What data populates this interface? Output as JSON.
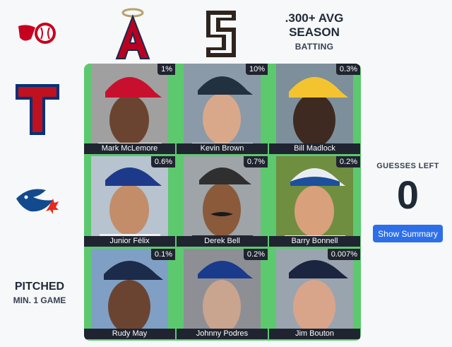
{
  "columns": [
    {
      "team": "angels-logo",
      "text": "A"
    },
    {
      "team": "padres-logo",
      "text": "SD"
    },
    {
      "title": ".300+ AVG SEASON",
      "subtitle": "BATTING"
    }
  ],
  "header": {
    "title_line1": ".300+ AVG",
    "title_line2": "SEASON",
    "subtitle": "BATTING"
  },
  "rows": [
    {
      "team": "reds-logo"
    },
    {
      "team": "rangers-logo",
      "text": "T"
    },
    {
      "team": "blue-jays-logo"
    }
  ],
  "row_criterion": {
    "title": "PITCHED",
    "subtitle": "MIN. 1 GAME"
  },
  "cells": [
    {
      "name": "Mark McLemore",
      "pct": "1%",
      "cap": "#c8102e",
      "skin": "#6b4431",
      "bg": "#a0a0a0"
    },
    {
      "name": "Kevin Brown",
      "pct": "10%",
      "cap": "#22313f",
      "skin": "#d9a88a",
      "bg": "#8a9aa8"
    },
    {
      "name": "Bill Madlock",
      "pct": "0.3%",
      "cap": "#f4c430",
      "skin": "#3e2a20",
      "bg": "#7d8f9a"
    },
    {
      "name": "Junior Félix",
      "pct": "0.6%",
      "cap": "#1d3a8a",
      "skin": "#c38d6a",
      "bg": "#b7c3cf"
    },
    {
      "name": "Derek Bell",
      "pct": "0.7%",
      "cap": "#2f2f2f",
      "skin": "#8a5a3b",
      "bg": "#9ea4a8"
    },
    {
      "name": "Barry Bonnell",
      "pct": "0.2%",
      "cap": "#e9edf2",
      "skin": "#d9a07c",
      "bg": "#6f8e3f"
    },
    {
      "name": "Rudy May",
      "pct": "0.1%",
      "cap": "#1c2b4a",
      "skin": "#6b4431",
      "bg": "#7fa0c4"
    },
    {
      "name": "Johnny Podres",
      "pct": "0.2%",
      "cap": "#1a3a8c",
      "skin": "#c9a48f",
      "bg": "#8d8f95"
    },
    {
      "name": "Jim Bouton",
      "pct": "0.007%",
      "cap": "#1b2540",
      "skin": "#d8a58a",
      "bg": "#9aa4ae"
    }
  ],
  "guesses": {
    "label": "GUESSES LEFT",
    "value": "0"
  },
  "summary_button": "Show Summary",
  "colors": {
    "grid_green": "#5cc96f",
    "label_bg": "#1f2430",
    "button": "#2d6fe8"
  }
}
